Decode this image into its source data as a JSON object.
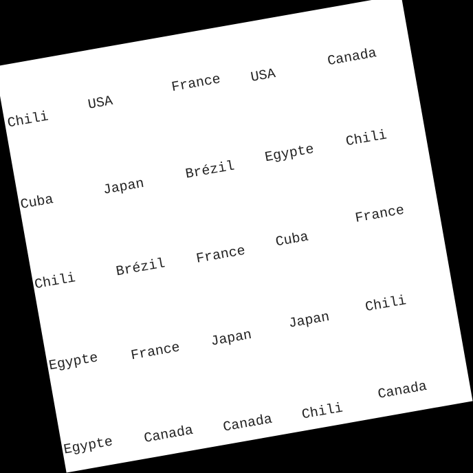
{
  "background_color": "#000000",
  "card_color": "#ffffff",
  "rows": [
    [
      "Chili",
      "USA",
      "France",
      "USA",
      "Canada"
    ],
    [
      "Cuba",
      "Japan",
      "Brézil",
      "Egypte",
      "Chili"
    ],
    [
      "Chili",
      "Brézil",
      "France",
      "Cuba",
      "France"
    ],
    [
      "Egypte",
      "France",
      "Japan",
      "Japan",
      "Chili"
    ],
    [
      "Egypte",
      "Canada",
      "Canada",
      "Chili",
      "Canada"
    ]
  ]
}
